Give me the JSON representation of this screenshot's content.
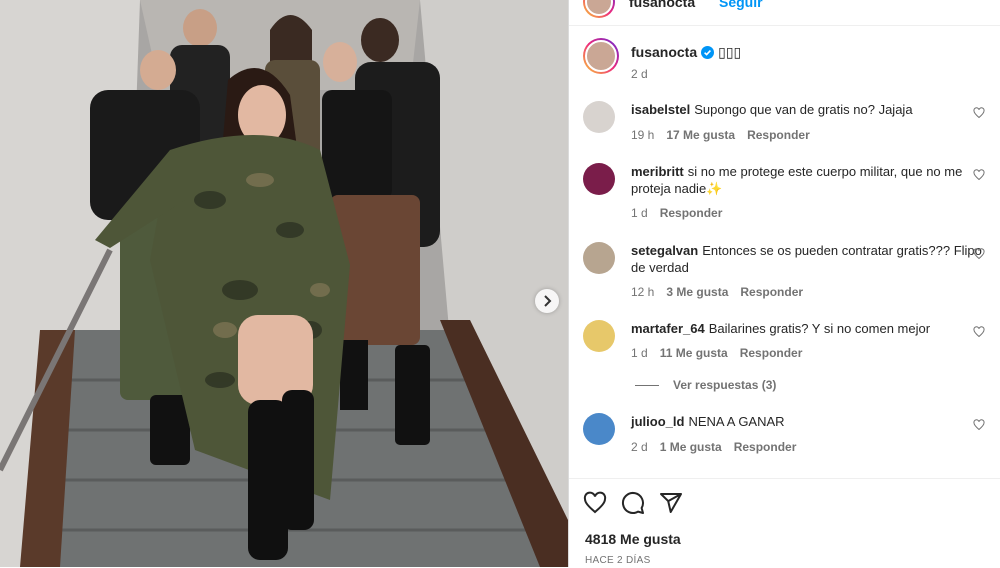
{
  "header": {
    "username": "fusanocta",
    "follow_label": "Seguir"
  },
  "caption": {
    "username": "fusanocta",
    "text": "▯▯▯",
    "time": "2 d"
  },
  "comments": [
    {
      "username": "isabelstel",
      "text": "Supongo que van de gratis no? Jajaja",
      "time": "19 h",
      "likes": "17 Me gusta",
      "reply": "Responder",
      "avatar_color": "#d8d3cf"
    },
    {
      "username": "meribritt",
      "text": "si no me protege este cuerpo militar, que no me proteja nadie",
      "emoji": "✨",
      "time": "1 d",
      "likes": "",
      "reply": "Responder",
      "avatar_color": "#7a1d4a"
    },
    {
      "username": "setegalvan",
      "text": "Entonces se os pueden contratar gratis??? Flipo de verdad",
      "time": "12 h",
      "likes": "3 Me gusta",
      "reply": "Responder",
      "avatar_color": "#b7a590"
    },
    {
      "username": "martafer_64",
      "text": "Bailarines gratis? Y si no comen mejor",
      "time": "1 d",
      "likes": "11 Me gusta",
      "reply": "Responder",
      "avatar_color": "#e7c86a"
    },
    {
      "username": "julioo_ld",
      "text": "NENA A GANAR",
      "time": "2 d",
      "likes": "1 Me gusta",
      "reply": "Responder",
      "avatar_color": "#4a88c9"
    }
  ],
  "view_replies": "Ver respuestas (3)",
  "actions": {
    "like_icon": "heart-icon",
    "comment_icon": "comment-icon",
    "share_icon": "share-icon"
  },
  "likes_count": "4818 Me gusta",
  "posted_ago": "HACE 2 DÍAS",
  "colors": {
    "accent": "#0095f6",
    "verified": "#0095f6",
    "muted": "#737373"
  }
}
